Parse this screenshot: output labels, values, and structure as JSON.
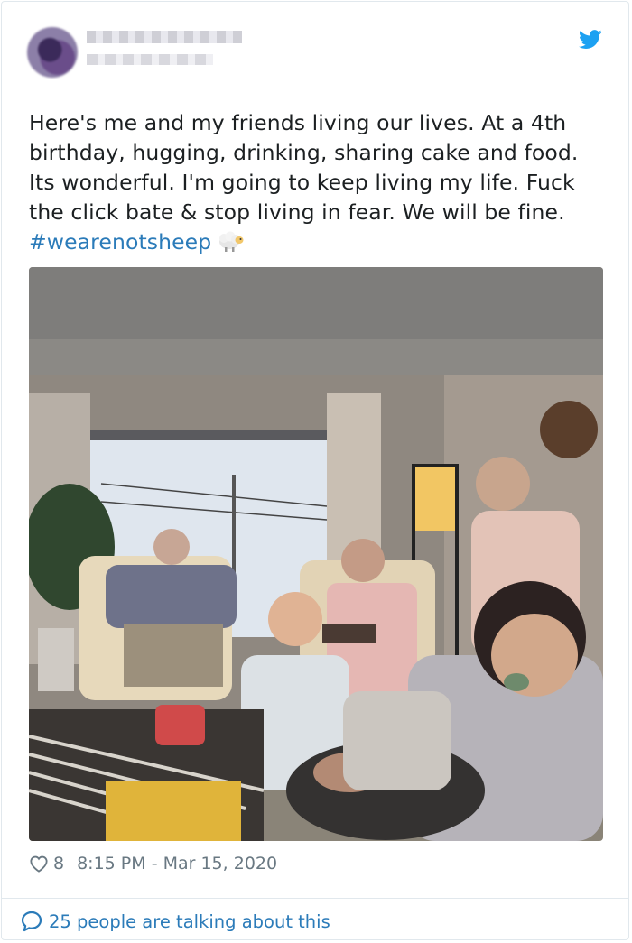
{
  "tweet": {
    "text_lines": [
      "Here's me and my friends living our lives. At a 4th",
      "birthday, hugging, drinking, sharing cake and food.",
      "Its wonderful. I'm going to keep living my life. Fuck",
      "the click bate & stop living in fear. We will be fine."
    ],
    "hashtag": "#wearenotsheep",
    "emoji_icon": "sheep-icon",
    "brand_icon": "twitter-bird-icon",
    "photo_description_icon": "photo",
    "like_count": "8",
    "timestamp": "8:15 PM - Mar 15, 2020",
    "talking": "25 people are talking about this"
  },
  "colors": {
    "text": "#1c2022",
    "link": "#2b7bb9",
    "meta": "#697882",
    "twitter_blue": "#1da1f2",
    "border": "#e1e8ed"
  }
}
